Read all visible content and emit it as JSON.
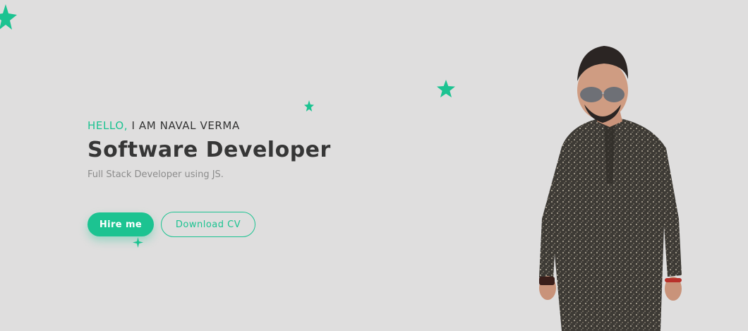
{
  "hero": {
    "greeting_accent": "HELLO,",
    "greeting_name": "I AM NAVAL VERMA",
    "title": "Software Developer",
    "subtitle": "Full Stack Developer using JS.",
    "hire_label": "Hire me",
    "cv_label": "Download CV"
  },
  "colors": {
    "accent": "#1cc391",
    "background": "#dfdede",
    "heading": "#363636",
    "muted": "#8c8c8c"
  },
  "icons": {
    "decorations": [
      "star-icon",
      "sparkle-icon"
    ],
    "portrait": "person-photo"
  }
}
